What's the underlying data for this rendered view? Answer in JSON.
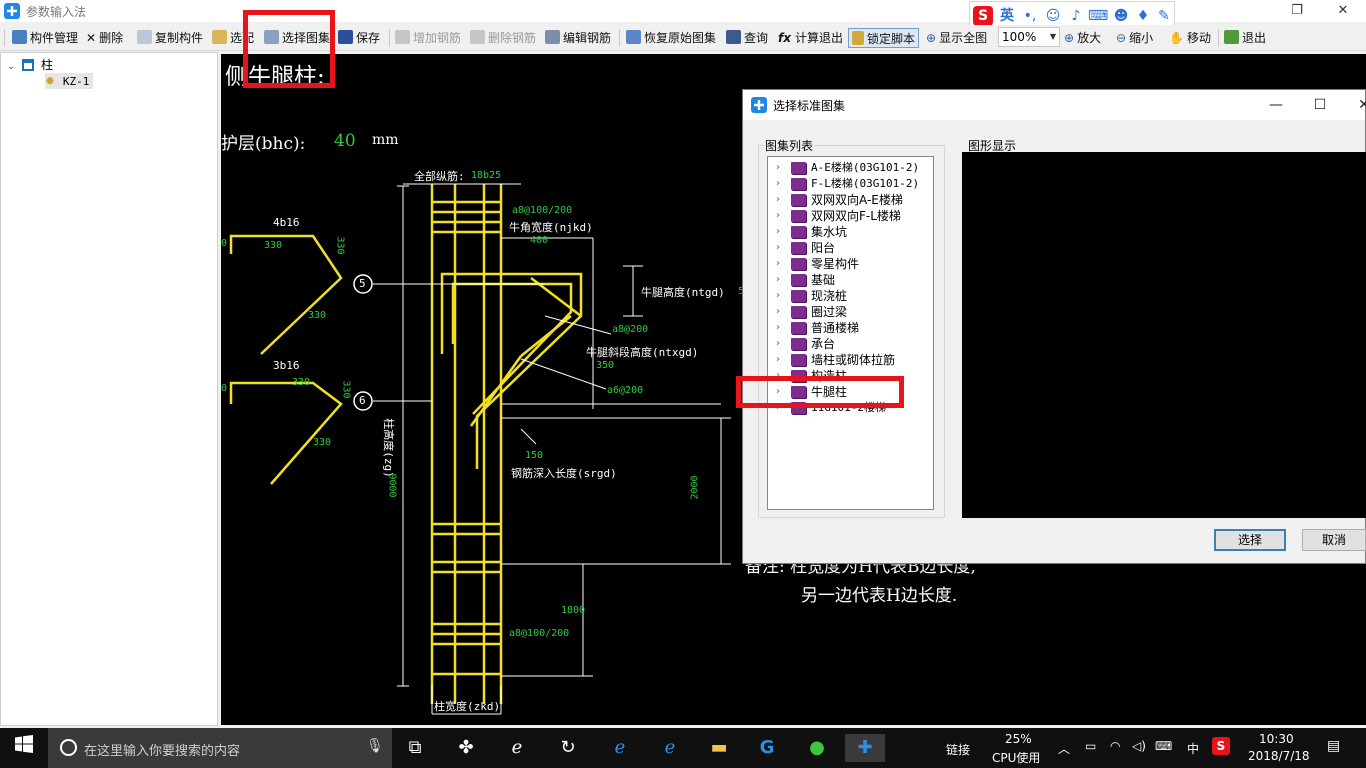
{
  "window": {
    "title": "参数输入法",
    "controls": {
      "restore": "❐",
      "close": "✕"
    }
  },
  "ime": {
    "brand": "S",
    "lang": "英"
  },
  "toolbar": {
    "component_mgmt": "构件管理",
    "delete": "删除",
    "copy_component": "复制构件",
    "select_component": "选配",
    "select_atlas": "选择图集",
    "save": "保存",
    "add_rebar": "增加钢筋",
    "delete_rebar": "删除钢筋",
    "edit_rebar": "编辑钢筋",
    "restore_atlas": "恢复原始图集",
    "query": "查询",
    "calc_exit": "计算退出",
    "lock_script": "锁定脚本",
    "show_all": "显示全图",
    "zoom_value": "100%",
    "zoom_in": "放大",
    "zoom_out": "缩小",
    "move": "移动",
    "exit": "退出"
  },
  "tree": {
    "root": "柱",
    "child": "KZ-1"
  },
  "drawing": {
    "heading": "侧牛腿柱:",
    "cover_label": "护层(bhc):",
    "cover_value": "40",
    "cover_unit": "mm",
    "all_long_bar_label": "全部纵筋:",
    "all_long_bar_value": "18b25",
    "bar1_label": "4b16",
    "bar1_seg_a": "330",
    "bar1_seg_b": "330",
    "bar1_seg_c": "330",
    "bar1_left": "0",
    "bar2_label": "3b16",
    "bar2_seg_a": "330",
    "bar2_seg_b": "330",
    "bar2_seg_c": "330",
    "bar2_left": "0",
    "marker5": "5",
    "marker6": "6",
    "stirrup_top": "a8@100/200",
    "bracket_width_label": "牛角宽度(njkd)",
    "bracket_width_value": "400",
    "bracket_height_label": "牛腿高度(ntgd)",
    "bracket_height_value": "5",
    "stirrup_a8": "a8@200",
    "slope_height_label": "牛腿斜段高度(ntxgd)",
    "slope_height_value": "350",
    "stirrup_a6": "a6@200",
    "anchor_value": "150",
    "anchor_label": "钢筋深入长度(srgd)",
    "dim_2000": "2000",
    "col_height_label": "柱高度(zg)",
    "col_height_value": "9000",
    "dim_1800": "1800",
    "stirrup_bottom": "a8@100/200",
    "col_width_label": "柱宽度(zkd)",
    "note_line1": "备注: 柱宽度为H代表B边长度,",
    "note_line2": "另一边代表H边长度."
  },
  "dialog": {
    "title": "选择标准图集",
    "list_label": "图集列表",
    "preview_label": "图形显示",
    "items": [
      "A-E楼梯(03G101-2)",
      "F-L楼梯(03G101-2)",
      "双网双向A-E楼梯",
      "双网双向F-L楼梯",
      "集水坑",
      "阳台",
      "零星构件",
      "基础",
      "现浇桩",
      "圈过梁",
      "普通楼梯",
      "承台",
      "墙柱或砌体拉筋",
      "构造柱",
      "牛腿柱",
      "11G101-2楼梯"
    ],
    "select_button": "选择",
    "cancel_button": "取消"
  },
  "taskbar": {
    "search_placeholder": "在这里输入你要搜索的内容",
    "link_label": "链接",
    "cpu_percent": "25%",
    "cpu_label": "CPU使用",
    "ime_lang": "中",
    "time": "10:30",
    "date": "2018/7/18"
  },
  "colors": {
    "highlight": "#e8141b",
    "rebar": "#f1e020",
    "dim_text": "#2ecc40",
    "canvas_bg": "#000000"
  }
}
